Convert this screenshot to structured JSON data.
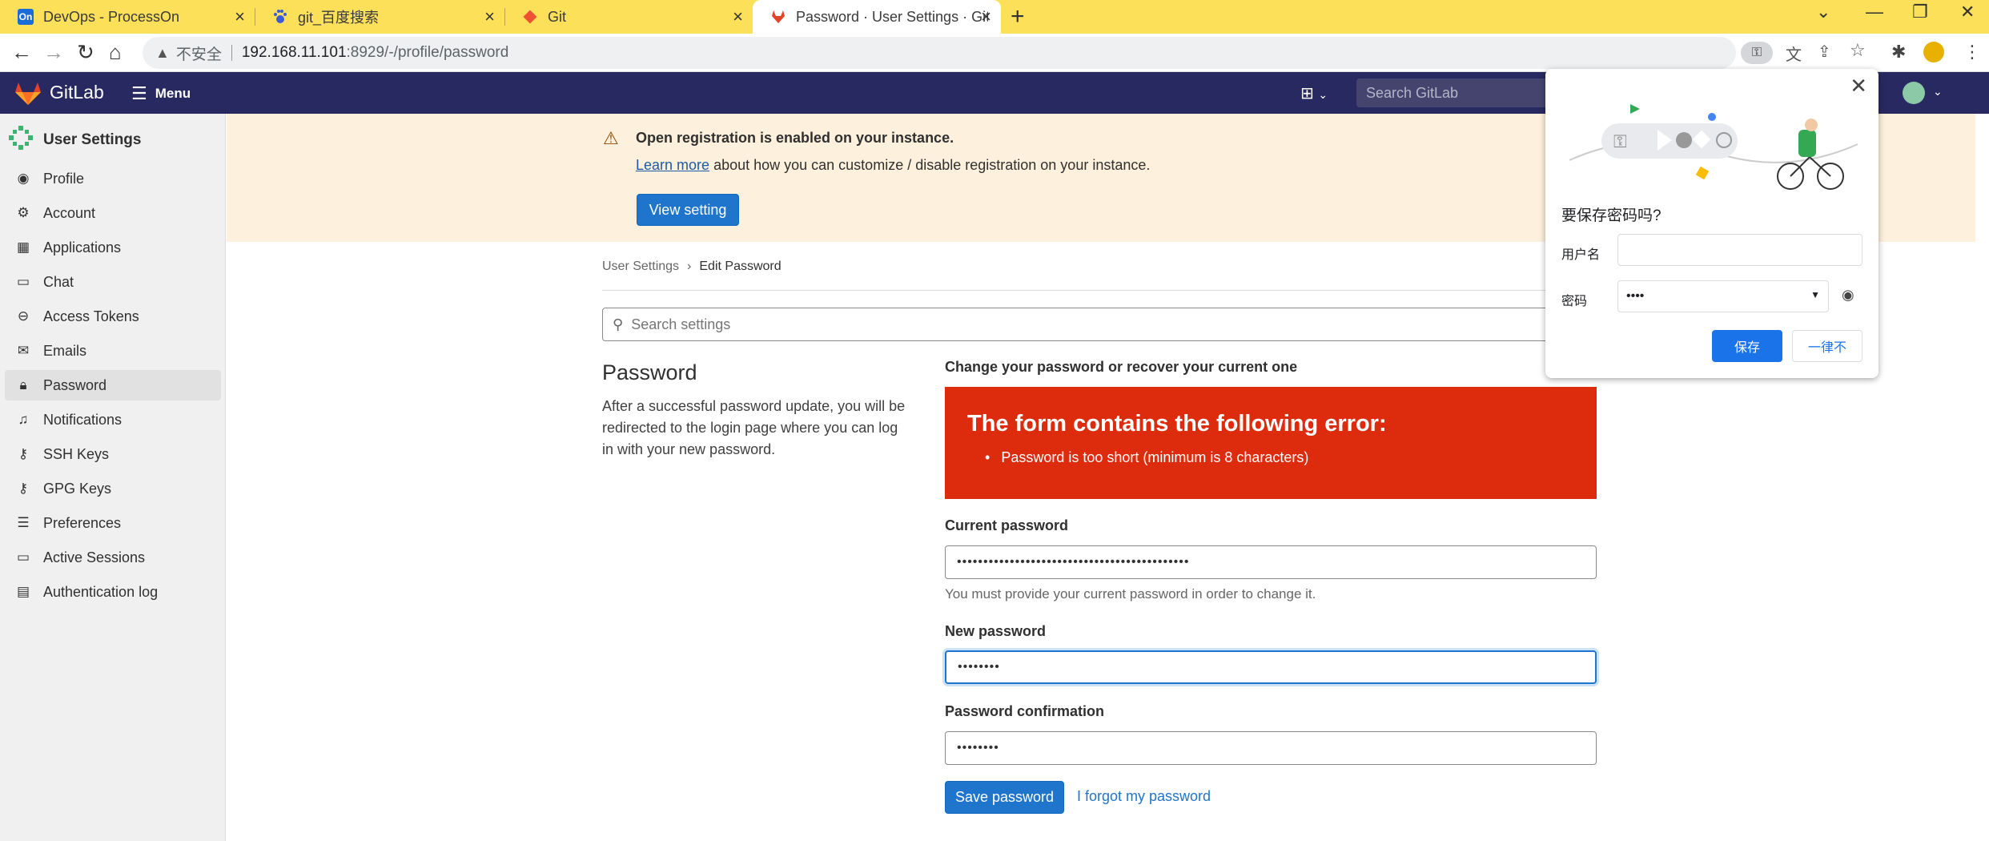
{
  "browser": {
    "tabs": [
      {
        "title": "DevOps - ProcessOn",
        "favicon": "On"
      },
      {
        "title": "git_百度搜索",
        "favicon": "paw-icon"
      },
      {
        "title": "Git",
        "favicon": "git-icon"
      },
      {
        "title": "Password · User Settings · GitL",
        "favicon": "gitlab-icon"
      }
    ],
    "insecure_label": "不安全",
    "url_host": "192.168.11.101",
    "url_path": ":8929/-/profile/password"
  },
  "header": {
    "brand": "GitLab",
    "menu_label": "Menu",
    "search_placeholder": "Search GitLab"
  },
  "sidebar": {
    "title": "User Settings",
    "items": [
      {
        "label": "Profile",
        "icon": "profile-icon"
      },
      {
        "label": "Account",
        "icon": "account-icon"
      },
      {
        "label": "Applications",
        "icon": "applications-icon"
      },
      {
        "label": "Chat",
        "icon": "chat-icon"
      },
      {
        "label": "Access Tokens",
        "icon": "token-icon"
      },
      {
        "label": "Emails",
        "icon": "mail-icon"
      },
      {
        "label": "Password",
        "icon": "lock-icon"
      },
      {
        "label": "Notifications",
        "icon": "bell-icon"
      },
      {
        "label": "SSH Keys",
        "icon": "key-icon"
      },
      {
        "label": "GPG Keys",
        "icon": "key-icon"
      },
      {
        "label": "Preferences",
        "icon": "preferences-icon"
      },
      {
        "label": "Active Sessions",
        "icon": "monitor-icon"
      },
      {
        "label": "Authentication log",
        "icon": "log-icon"
      }
    ],
    "active_index": 6
  },
  "banner": {
    "title": "Open registration is enabled on your instance.",
    "link": "Learn more",
    "desc_rest": " about how you can customize / disable registration on your instance.",
    "button": "View setting"
  },
  "breadcrumb": {
    "parent": "User Settings",
    "current": "Edit Password"
  },
  "search_settings_placeholder": "Search settings",
  "section": {
    "title": "Password",
    "desc": "After a successful password update, you will be redirected to the login page where you can log in with your new password."
  },
  "form": {
    "heading": "Change your password or recover your current one",
    "error_title": "The form contains the following error:",
    "error_item": "Password is too short (minimum is 8 characters)",
    "current_label": "Current password",
    "current_value": "••••••••••••••••••••••••••••••••••••••••••••",
    "current_help": "You must provide your current password in order to change it.",
    "new_label": "New password",
    "new_value": "••••••••",
    "confirm_label": "Password confirmation",
    "confirm_value": "••••••••",
    "save_button": "Save password",
    "forgot_link": "I forgot my password"
  },
  "password_popup": {
    "question": "要保存密码吗?",
    "username_label": "用户名",
    "username_value": "",
    "password_label": "密码",
    "password_value": "••••",
    "save_button": "保存",
    "never_button": "一律不"
  }
}
